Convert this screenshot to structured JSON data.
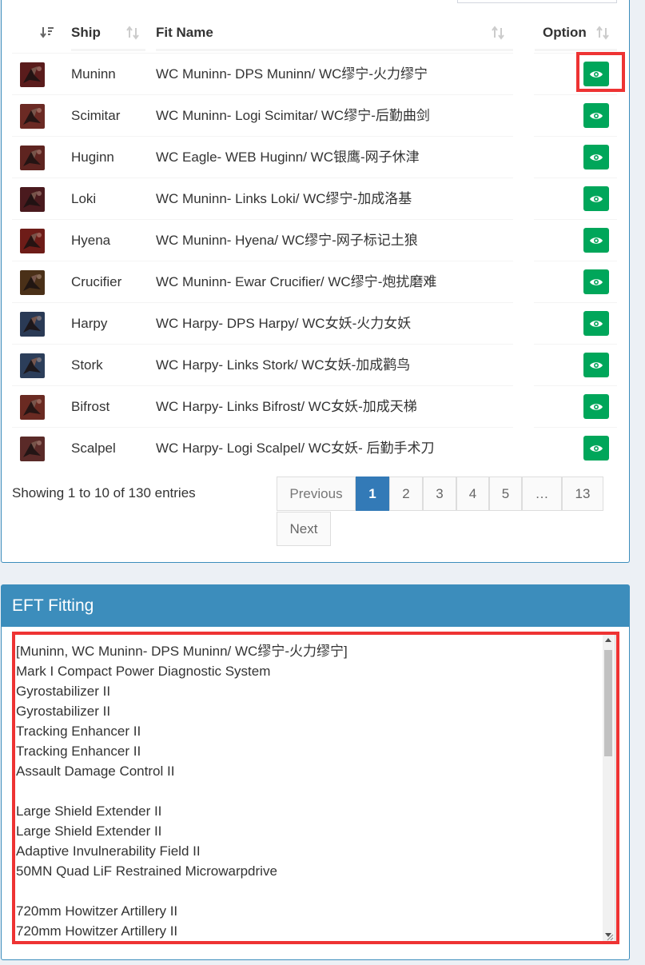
{
  "table": {
    "headers": {
      "ship": "Ship",
      "fit_name": "Fit Name",
      "option": "Option"
    },
    "rows": [
      {
        "ship": "Muninn",
        "fit": "WC Muninn- DPS Muninn/ WC缪宁-火力缪宁",
        "icon": "muninn-ship-icon",
        "color": "#5a1c1c"
      },
      {
        "ship": "Scimitar",
        "fit": "WC Muninn- Logi Scimitar/ WC缪宁-后勤曲剑",
        "icon": "scimitar-ship-icon",
        "color": "#6b2a24"
      },
      {
        "ship": "Huginn",
        "fit": "WC Eagle- WEB Huginn/ WC银鹰-网子休津",
        "icon": "huginn-ship-icon",
        "color": "#5e2420"
      },
      {
        "ship": "Loki",
        "fit": "WC Muninn- Links Loki/ WC缪宁-加成洛基",
        "icon": "loki-ship-icon",
        "color": "#4a1a1e"
      },
      {
        "ship": "Hyena",
        "fit": "WC Muninn- Hyena/ WC缪宁-网子标记土狼",
        "icon": "hyena-ship-icon",
        "color": "#6e1c18"
      },
      {
        "ship": "Crucifier",
        "fit": "WC Muninn- Ewar Crucifier/ WC缪宁-炮扰磨难",
        "icon": "crucifier-ship-icon",
        "color": "#4a3018"
      },
      {
        "ship": "Harpy",
        "fit": "WC Harpy- DPS Harpy/ WC女妖-火力女妖",
        "icon": "harpy-ship-icon",
        "color": "#2a3a55"
      },
      {
        "ship": "Stork",
        "fit": "WC Harpy- Links Stork/ WC女妖-加成鹳鸟",
        "icon": "stork-ship-icon",
        "color": "#2c3e5a"
      },
      {
        "ship": "Bifrost",
        "fit": "WC Harpy- Links Bifrost/ WC女妖-加成天梯",
        "icon": "bifrost-ship-icon",
        "color": "#6a2a22"
      },
      {
        "ship": "Scalpel",
        "fit": "WC Harpy- Logi Scalpel/ WC女妖- 后勤手术刀",
        "icon": "scalpel-ship-icon",
        "color": "#5a2a28"
      }
    ]
  },
  "info": "Showing 1 to 10 of 130 entries",
  "pagination": {
    "previous": "Previous",
    "pages": [
      "1",
      "2",
      "3",
      "4",
      "5",
      "…",
      "13"
    ],
    "active": "1",
    "next": "Next"
  },
  "eft": {
    "title": "EFT Fitting",
    "lines": [
      "[Muninn, WC Muninn- DPS Muninn/ WC缪宁-火力缪宁]",
      "Mark I Compact Power Diagnostic System",
      "Gyrostabilizer II",
      "Gyrostabilizer II",
      "Tracking Enhancer II",
      "Tracking Enhancer II",
      "Assault Damage Control II",
      "",
      "Large Shield Extender II",
      "Large Shield Extender II",
      "Adaptive Invulnerability Field II",
      "50MN Quad LiF Restrained Microwarpdrive",
      "",
      "720mm Howitzer Artillery II",
      "720mm Howitzer Artillery II"
    ]
  },
  "colors": {
    "accent": "#3c8dbc",
    "view_button": "#00a65a",
    "highlight": "#ee3333",
    "page_active": "#337ab7"
  }
}
